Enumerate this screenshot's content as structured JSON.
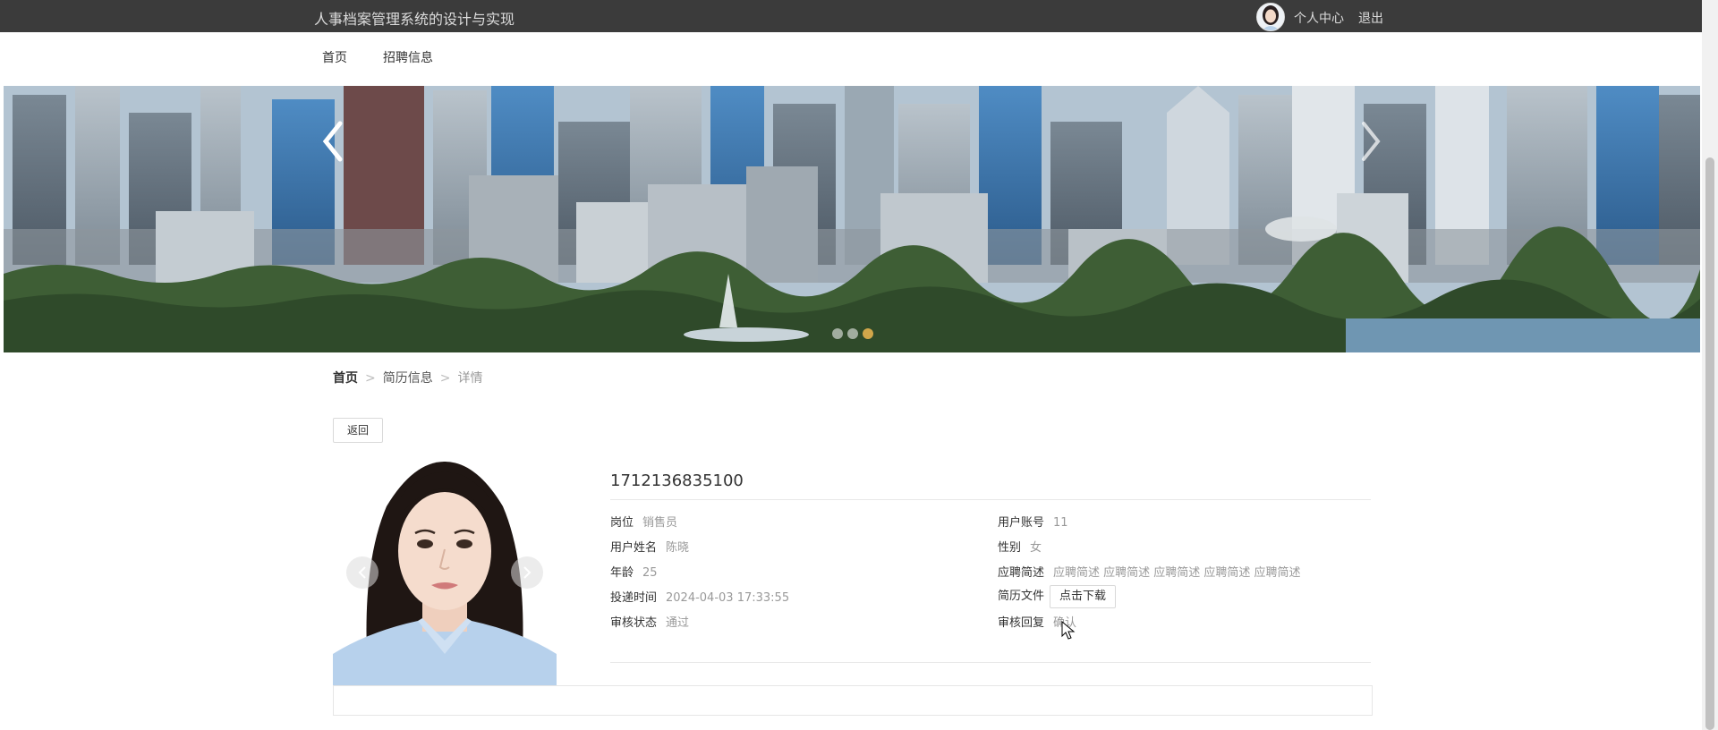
{
  "header": {
    "app_title": "人事档案管理系统的设计与实现",
    "profile_link": "个人中心",
    "logout_link": "退出"
  },
  "nav": {
    "items": [
      {
        "label": "首页"
      },
      {
        "label": "招聘信息"
      }
    ]
  },
  "banner": {
    "slide_count": 3,
    "active_slide": 3
  },
  "breadcrumb": {
    "home": "首页",
    "section": "简历信息",
    "current": "详情",
    "separator": ">"
  },
  "back_button": "返回",
  "detail": {
    "id": "1712136835100",
    "left": [
      {
        "key": "岗位",
        "value": "销售员"
      },
      {
        "key": "用户姓名",
        "value": "陈晓"
      },
      {
        "key": "年龄",
        "value": "25"
      },
      {
        "key": "投递时间",
        "value": "2024-04-03 17:33:55"
      },
      {
        "key": "审核状态",
        "value": "通过"
      }
    ],
    "right": [
      {
        "key": "用户账号",
        "value": "11"
      },
      {
        "key": "性别",
        "value": "女"
      },
      {
        "key": "应聘简述",
        "value": "应聘简述 应聘简述 应聘简述 应聘简述 应聘简述"
      },
      {
        "key": "简历文件",
        "button": "点击下载"
      },
      {
        "key": "审核回复",
        "value": "确认"
      }
    ]
  },
  "colors": {
    "topbar": "#3b3b3b",
    "accent_dot": "#d1a64a",
    "muted_text": "#999999"
  },
  "icons": {
    "prev": "chevron-left-icon",
    "next": "chevron-right-icon",
    "cursor": "mouse-pointer-icon"
  }
}
